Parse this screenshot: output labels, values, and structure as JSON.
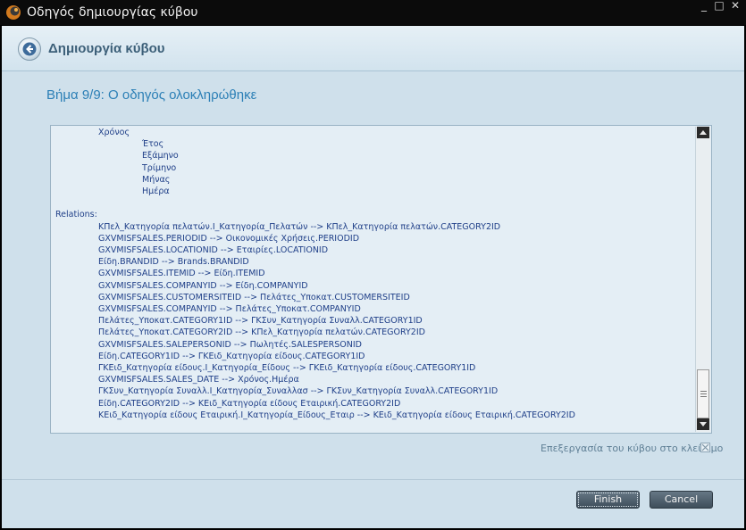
{
  "window": {
    "title": "Οδηγός δημιουργίας κύβου",
    "controls": [
      "_",
      "□",
      "✕"
    ]
  },
  "header": {
    "title": "Δημιουργία κύβου",
    "back_icon": "back-arrow-icon"
  },
  "step": {
    "title": "Βήμα 9/9: Ο οδηγός ολοκληρώθηκε"
  },
  "log": {
    "lines": [
      {
        "indent": 2,
        "text": "Χρόνος"
      },
      {
        "indent": 3,
        "text": "Έτος"
      },
      {
        "indent": 3,
        "text": "Εξάμηνο"
      },
      {
        "indent": 3,
        "text": "Τρίμηνο"
      },
      {
        "indent": 3,
        "text": "Μήνας"
      },
      {
        "indent": 3,
        "text": "Ημέρα"
      },
      {
        "indent": 0,
        "text": ""
      },
      {
        "indent": 0,
        "text": "Relations:"
      },
      {
        "indent": 2,
        "text": "ΚΠελ_Κατηγορία πελατών.Ι_Κατηγορία_Πελατών --> ΚΠελ_Κατηγορία πελατών.CATEGORY2ID"
      },
      {
        "indent": 2,
        "text": "GXVMISFSALES.PERIODID --> Οικονομικές Χρήσεις.PERIODID"
      },
      {
        "indent": 2,
        "text": "GXVMISFSALES.LOCATIONID --> Εταιρίες.LOCATIONID"
      },
      {
        "indent": 2,
        "text": "Είδη.BRANDID --> Brands.BRANDID"
      },
      {
        "indent": 2,
        "text": "GXVMISFSALES.ITEMID --> Είδη.ITEMID"
      },
      {
        "indent": 2,
        "text": "GXVMISFSALES.COMPANYID --> Είδη.COMPANYID"
      },
      {
        "indent": 2,
        "text": "GXVMISFSALES.CUSTOMERSITEID --> Πελάτες_Υποκατ.CUSTOMERSITEID"
      },
      {
        "indent": 2,
        "text": "GXVMISFSALES.COMPANYID --> Πελάτες_Υποκατ.COMPANYID"
      },
      {
        "indent": 2,
        "text": "Πελάτες_Υποκατ.CATEGORY1ID --> ΓΚΣυν_Κατηγορία Συναλλ.CATEGORY1ID"
      },
      {
        "indent": 2,
        "text": "Πελάτες_Υποκατ.CATEGORY2ID --> ΚΠελ_Κατηγορία πελατών.CATEGORY2ID"
      },
      {
        "indent": 2,
        "text": "GXVMISFSALES.SALEPERSONID --> Πωλητές.SALESPERSONID"
      },
      {
        "indent": 2,
        "text": "Είδη.CATEGORY1ID --> ΓΚΕιδ_Κατηγορία είδους.CATEGORY1ID"
      },
      {
        "indent": 2,
        "text": "ΓΚΕιδ_Κατηγορία είδους.Ι_Κατηγορία_Είδους --> ΓΚΕιδ_Κατηγορία είδους.CATEGORY1ID"
      },
      {
        "indent": 2,
        "text": "GXVMISFSALES.SALES_DATE --> Χρόνος.Ημέρα"
      },
      {
        "indent": 2,
        "text": "ΓΚΣυν_Κατηγορία Συναλλ.Ι_Κατηγορία_Συναλλασ --> ΓΚΣυν_Κατηγορία Συναλλ.CATEGORY1ID"
      },
      {
        "indent": 2,
        "text": "Είδη.CATEGORY2ID --> ΚΕιδ_Κατηγορία είδους Εταιρική.CATEGORY2ID"
      },
      {
        "indent": 2,
        "text": "ΚΕιδ_Κατηγορία είδους Εταιρική.Ι_Κατηγορία_Είδους_Εταιρ --> ΚΕιδ_Κατηγορία είδους Εταιρική.CATEGORY2ID"
      }
    ]
  },
  "options": {
    "edit_on_close_label": "Επεξεργασία του κύβου στο κλείσιμο",
    "edit_on_close_checked": true,
    "checked_mark": "✕"
  },
  "buttons": {
    "finish": "Finish",
    "cancel": "Cancel"
  },
  "colors": {
    "accent": "#2b7fb6",
    "background": "#cfe0eb",
    "log_text": "#1f3f88"
  }
}
